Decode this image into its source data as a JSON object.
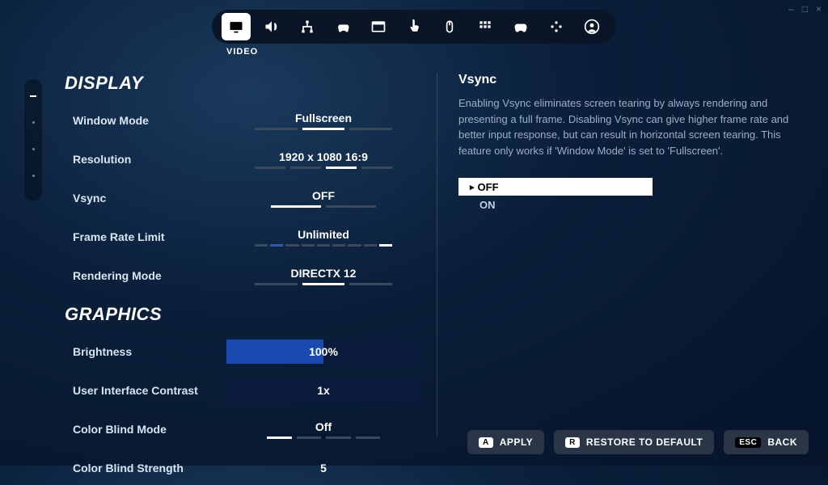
{
  "window_controls": {
    "minimize": "–",
    "maximize": "□",
    "close": "×"
  },
  "topTabs": {
    "active_label": "VIDEO"
  },
  "sections": {
    "display": "DISPLAY",
    "graphics": "GRAPHICS"
  },
  "rows": {
    "window_mode": {
      "label": "Window Mode",
      "value": "Fullscreen"
    },
    "resolution": {
      "label": "Resolution",
      "value": "1920 x 1080 16:9"
    },
    "vsync": {
      "label": "Vsync",
      "value": "OFF"
    },
    "frame_rate": {
      "label": "Frame Rate Limit",
      "value": "Unlimited"
    },
    "rendering": {
      "label": "Rendering Mode",
      "value": "DIRECTX 12"
    },
    "brightness": {
      "label": "Brightness",
      "value": "100%"
    },
    "ui_contrast": {
      "label": "User Interface Contrast",
      "value": "1x"
    },
    "cb_mode": {
      "label": "Color Blind Mode",
      "value": "Off"
    },
    "cb_strength": {
      "label": "Color Blind Strength",
      "value": "5"
    }
  },
  "info": {
    "title": "Vsync",
    "text": "Enabling Vsync eliminates screen tearing by always rendering and presenting a full frame. Disabling Vsync can give higher frame rate and better input response, but can result in horizontal screen tearing. This feature only works if 'Window Mode' is set to 'Fullscreen'.",
    "options": {
      "off": "OFF",
      "on": "ON"
    }
  },
  "footer": {
    "apply": {
      "key": "A",
      "label": "APPLY"
    },
    "restore": {
      "key": "R",
      "label": "RESTORE TO DEFAULT"
    },
    "back": {
      "key": "ESC",
      "label": "BACK"
    }
  }
}
